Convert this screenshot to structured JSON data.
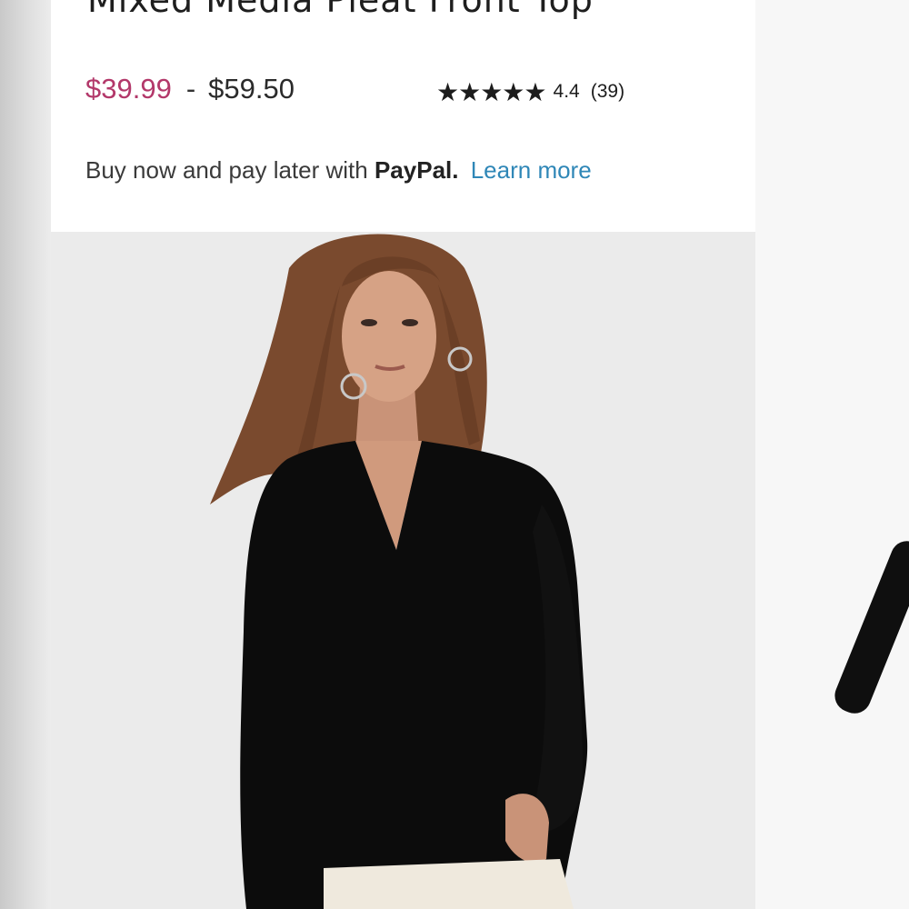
{
  "product": {
    "title": "Mixed Media Pleat Front Top",
    "price_low": "$39.99",
    "price_separator": "-",
    "price_high": "$59.50",
    "rating_stars": "★★★★★",
    "rating_value": "4.4",
    "review_count": "(39)"
  },
  "paypal": {
    "text": "Buy now and pay later with",
    "brand": "PayPal.",
    "link": "Learn more"
  },
  "colors": {
    "sale_price": "#b3386a",
    "link": "#2f87b7",
    "text": "#1e1e1e"
  }
}
